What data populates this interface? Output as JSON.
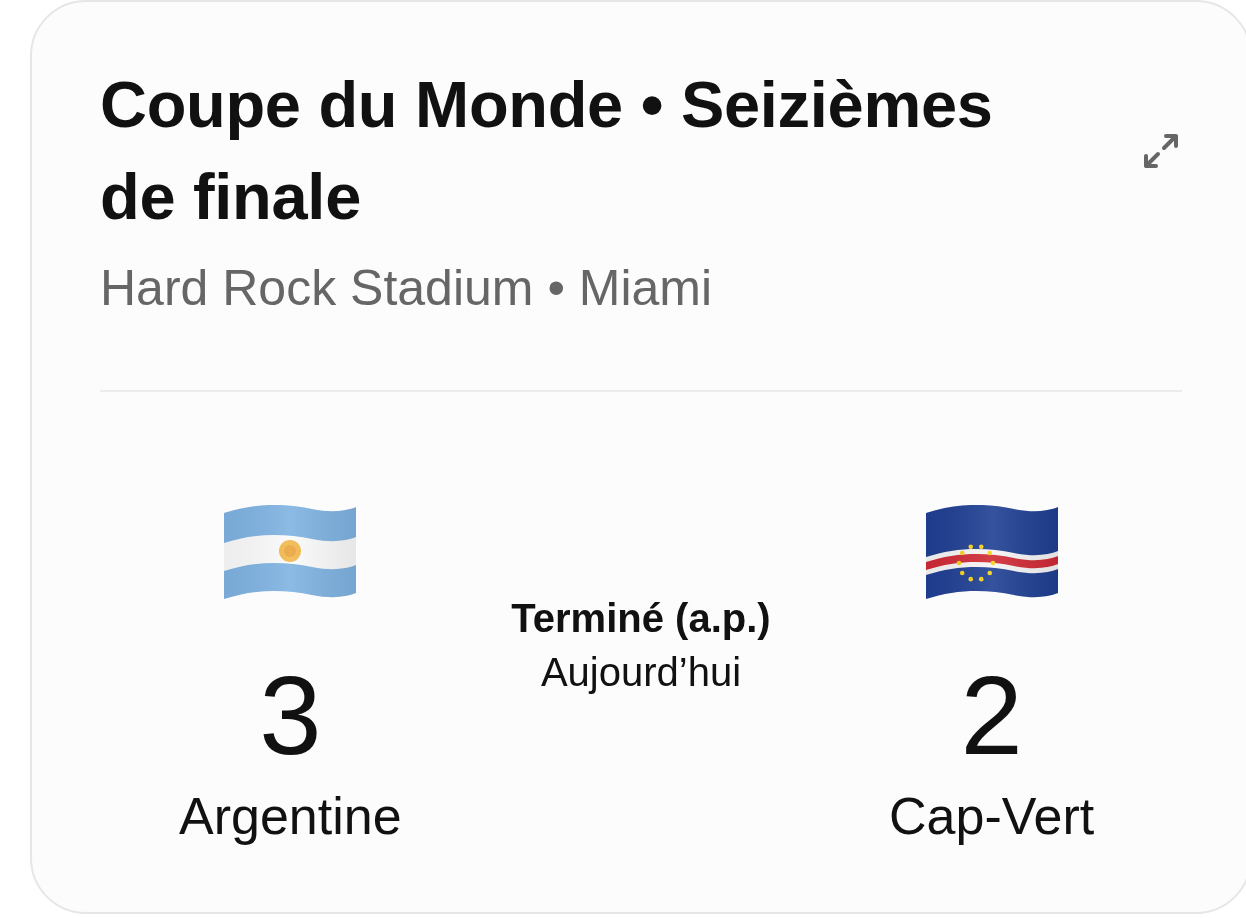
{
  "card": {
    "title": "Coupe du Monde • Seizièmes de finale",
    "subtitle": "Hard Rock Stadium • Miami"
  },
  "teams": [
    {
      "name": "Argentine",
      "score": "3"
    },
    {
      "name": "Cap-Vert",
      "score": "2"
    }
  ],
  "match": {
    "status": "Terminé (a.p.)",
    "date": "Aujourd’hui"
  }
}
